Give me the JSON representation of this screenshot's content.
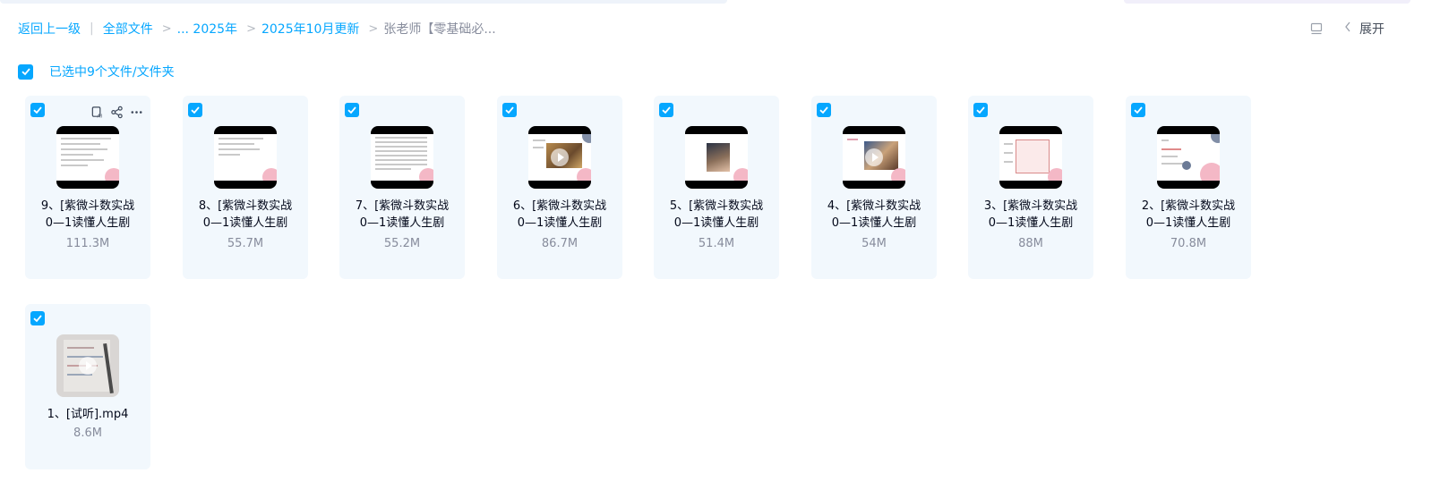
{
  "breadcrumb": {
    "back": "返回上一级",
    "all_files": "全部文件",
    "ellipsis_year": "... 2025年",
    "update": "2025年10月更新",
    "current": "张老师【零基础必..."
  },
  "toolbar": {
    "expand_label": "展开"
  },
  "selection": {
    "label": "已选中9个文件/文件夹"
  },
  "files": [
    {
      "name": "9、[紫微斗数实战\n0—1读懂人生剧",
      "size": "111.3M"
    },
    {
      "name": "8、[紫微斗数实战\n0—1读懂人生剧",
      "size": "55.7M"
    },
    {
      "name": "7、[紫微斗数实战\n0—1读懂人生剧",
      "size": "55.2M"
    },
    {
      "name": "6、[紫微斗数实战\n0—1读懂人生剧",
      "size": "86.7M"
    },
    {
      "name": "5、[紫微斗数实战\n0—1读懂人生剧",
      "size": "51.4M"
    },
    {
      "name": "4、[紫微斗数实战\n0—1读懂人生剧",
      "size": "54M"
    },
    {
      "name": "3、[紫微斗数实战\n0—1读懂人生剧",
      "size": "88M"
    },
    {
      "name": "2、[紫微斗数实战\n0—1读懂人生剧",
      "size": "70.8M"
    },
    {
      "name": "1、[试听].mp4",
      "size": "8.6M"
    }
  ],
  "colors": {
    "accent": "#06a7ff",
    "card_bg": "#f2f8fd",
    "text_primary": "#03081a",
    "text_secondary": "#878c9c"
  },
  "icons": {
    "checkbox": "checkbox-checked-icon",
    "summary": "ai-summary-icon",
    "share": "share-icon",
    "more": "more-icon",
    "layout": "layout-icon",
    "collapse": "chevron-left-icon"
  }
}
